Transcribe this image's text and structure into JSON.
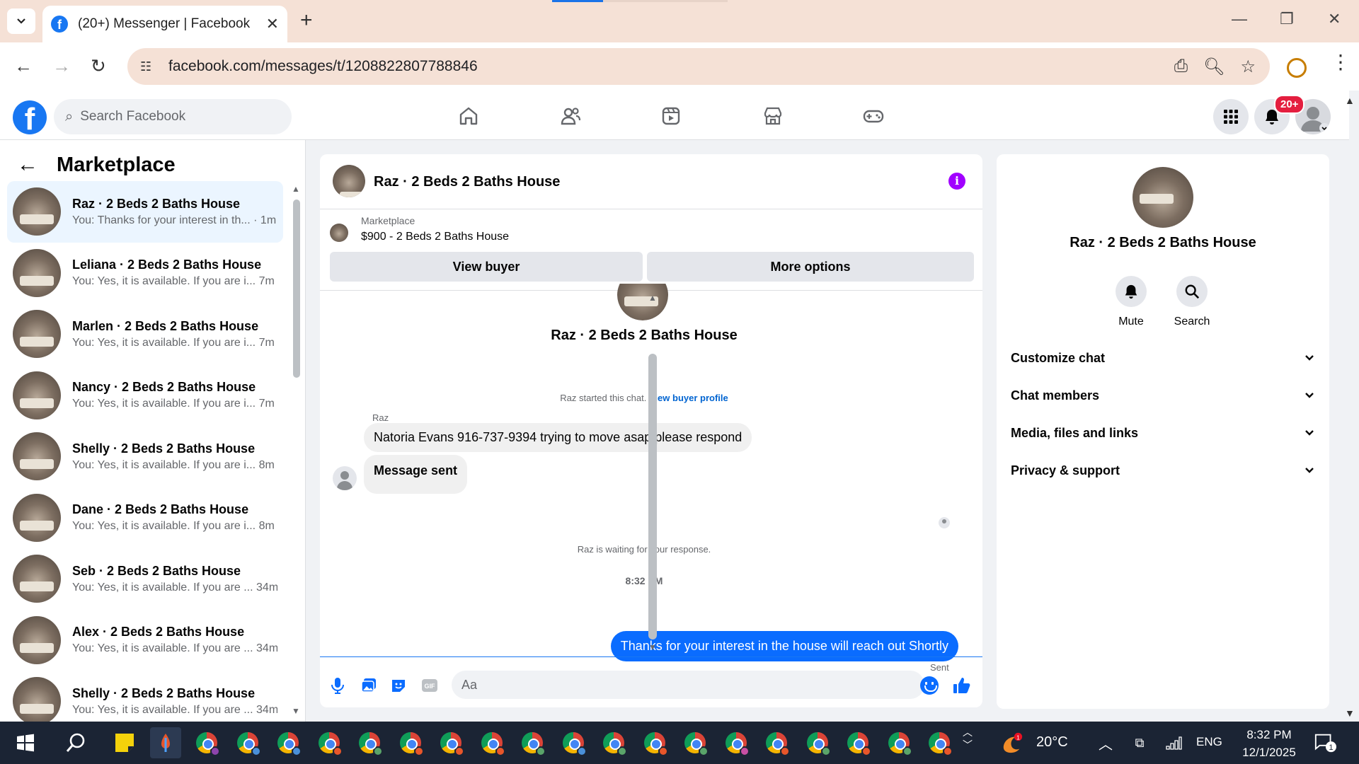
{
  "browser": {
    "tab_title": "(20+) Messenger | Facebook",
    "url": "facebook.com/messages/t/1208822807788846"
  },
  "fb": {
    "search_placeholder": "Search Facebook",
    "notification_count": "20+"
  },
  "sidebar": {
    "title": "Marketplace",
    "conversations": [
      {
        "name": "Raz · 2 Beds 2 Baths House",
        "preview": "You: Thanks for your interest in th...",
        "time": "· 1m",
        "active": true
      },
      {
        "name": "Leliana · 2 Beds 2 Baths House",
        "preview": "You: Yes, it is available. If you are i...",
        "time": "7m"
      },
      {
        "name": "Marlen · 2 Beds 2 Baths House",
        "preview": "You: Yes, it is available. If you are i...",
        "time": "7m"
      },
      {
        "name": "Nancy · 2 Beds 2 Baths House",
        "preview": "You: Yes, it is available. If you are i...",
        "time": "7m"
      },
      {
        "name": "Shelly · 2 Beds 2 Baths House",
        "preview": "You: Yes, it is available. If you are i...",
        "time": "8m"
      },
      {
        "name": "Dane · 2 Beds 2 Baths House",
        "preview": "You: Yes, it is available. If you are i...",
        "time": "8m"
      },
      {
        "name": "Seb · 2 Beds 2 Baths House",
        "preview": "You: Yes, it is available. If you are ...",
        "time": "34m"
      },
      {
        "name": "Alex · 2 Beds 2 Baths House",
        "preview": "You: Yes, it is available. If you are ...",
        "time": "34m"
      },
      {
        "name": "Shelly · 2 Beds 2 Baths House",
        "preview": "You: Yes, it is available. If you are ...",
        "time": "34m"
      }
    ]
  },
  "chat": {
    "title": "Raz · 2 Beds 2 Baths House",
    "listing_source": "Marketplace",
    "listing_price": "$900 - 2 Beds 2 Baths House",
    "view_buyer": "View buyer",
    "more_options": "More options",
    "intro_name": "Raz · 2 Beds 2 Baths House",
    "started_text": "Raz started this chat.",
    "started_link": "View buyer profile",
    "sender": "Raz",
    "messages_in": [
      "Natoria Evans 916-737-9394 trying to move asap please respond",
      "Message sent"
    ],
    "waiting": "Raz is waiting for your response.",
    "time": "8:32 PM",
    "message_out": "Thanks for your interest in the house will reach out Shortly",
    "status": "Sent",
    "composer_placeholder": "Aa"
  },
  "details": {
    "name": "Raz · 2 Beds 2 Baths House",
    "mute": "Mute",
    "search": "Search",
    "sections": [
      "Customize chat",
      "Chat members",
      "Media, files and links",
      "Privacy & support"
    ]
  },
  "taskbar": {
    "temperature": "20°C",
    "weather_badge": "1",
    "language": "ENG",
    "time": "8:32 PM",
    "date": "12/1/2025",
    "notification_count": "1"
  },
  "colors": {
    "fb_blue": "#1877f2",
    "outgoing_bubble": "#0a6cff",
    "info_icon": "#a100ff",
    "badge_red": "#e41e3f"
  }
}
